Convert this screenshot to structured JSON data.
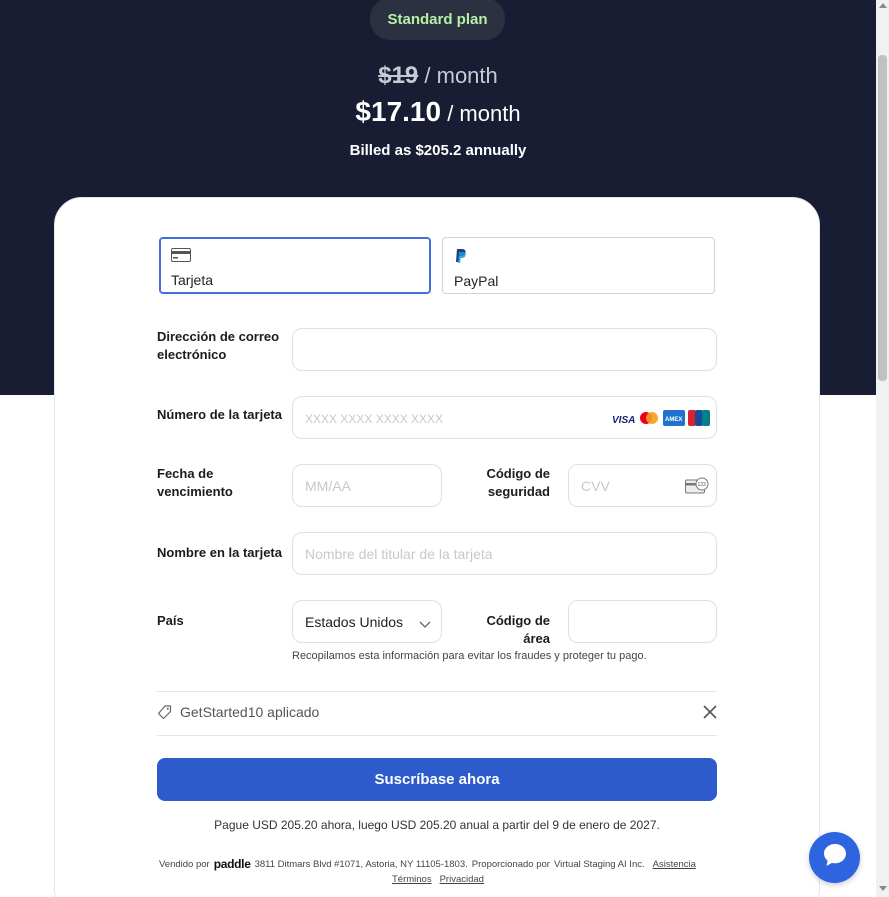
{
  "header": {
    "plan_name": "Standard plan",
    "old_price": "$19",
    "old_period": "/ month",
    "new_price": "$17.10",
    "new_period": "/ month",
    "billed_text": "Billed as $205.2 annually"
  },
  "payment_methods": [
    {
      "label": "Tarjeta",
      "icon": "credit-card-icon",
      "selected": true
    },
    {
      "label": "PayPal",
      "icon": "paypal-icon",
      "selected": false
    }
  ],
  "form": {
    "email": {
      "label_line1": "Dirección de correo",
      "label_line2": "electrónico",
      "value": ""
    },
    "card_number": {
      "label": "Número de la tarjeta",
      "placeholder": "XXXX XXXX XXXX XXXX",
      "brands": [
        "visa-icon",
        "mastercard-icon",
        "amex-icon",
        "unionpay-icon"
      ]
    },
    "expiry": {
      "label_line1": "Fecha de",
      "label_line2": "vencimiento",
      "placeholder": "MM/AA"
    },
    "cvv": {
      "label_line1": "Código de",
      "label_line2": "seguridad",
      "placeholder": "CVV"
    },
    "cardholder": {
      "label": "Nombre en la tarjeta",
      "placeholder": "Nombre del titular de la tarjeta"
    },
    "country": {
      "label": "País",
      "value": "Estados Unidos"
    },
    "postal": {
      "label": "Código de área",
      "value": ""
    },
    "hint": "Recopilamos esta información para evitar los fraudes y proteger tu pago."
  },
  "coupon": {
    "text": "GetStarted10 aplicado"
  },
  "submit": {
    "label": "Suscríbase ahora"
  },
  "payment_note": "Pague USD 205.20 ahora, luego USD 205.20 anual a partir del 9 de enero de 2027.",
  "footer": {
    "sold_by": "Vendido por",
    "paddle": "paddle",
    "address": "3811 Ditmars Blvd #1071, Astoria, NY 11105-1803.",
    "provided_by": "Proporcionado por",
    "company": "Virtual Staging AI Inc.",
    "support": "Asistencia",
    "terms": "Términos",
    "privacy": "Privacidad"
  },
  "colors": {
    "hero_bg": "#181d33",
    "accent": "#2d5bcb",
    "plan_text": "#b6f0a4",
    "chat_button": "#2f64e0"
  }
}
